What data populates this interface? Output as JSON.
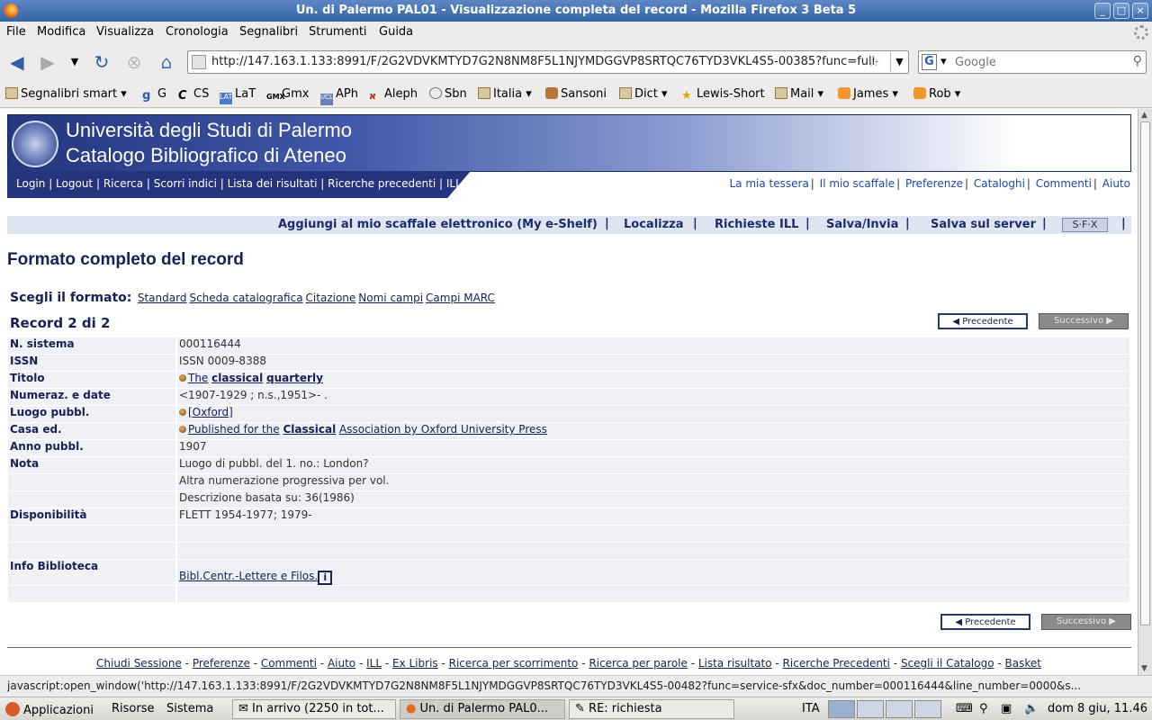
{
  "window": {
    "title": "Un. di Palermo PAL01 - Visualizzazione completa del record - Mozilla Firefox 3 Beta 5",
    "buttons": [
      "_",
      "□",
      "×"
    ]
  },
  "menu": [
    "File",
    "Modifica",
    "Visualizza",
    "Cronologia",
    "Segnalibri",
    "Strumenti",
    "Guida"
  ],
  "nav": {
    "url": "http://147.163.1.133:8991/F/2G2VDVKMTYD7G2N8NM8F5L1NJYMDGGVP8SRTQC76TYD3VKL4S5-00385?func=full-",
    "search_placeholder": "Google",
    "search_engine": "G"
  },
  "bookmarks": [
    {
      "label": "Segnalibri smart",
      "icon": "smart-bookmarks-icon",
      "dropdown": true
    },
    {
      "label": "G",
      "icon": "google-icon"
    },
    {
      "label": "CS",
      "icon": "cs-icon"
    },
    {
      "label": "LaT",
      "icon": "lat-icon"
    },
    {
      "label": "Gmx",
      "icon": "gmx-icon"
    },
    {
      "label": "APh",
      "icon": "aph-icon"
    },
    {
      "label": "Aleph",
      "icon": "aleph-icon"
    },
    {
      "label": "Sbn",
      "icon": "sbn-icon"
    },
    {
      "label": "Italia",
      "icon": "folder-icon",
      "dropdown": true
    },
    {
      "label": "Sansoni",
      "icon": "sansoni-icon"
    },
    {
      "label": "Dict",
      "icon": "folder-icon",
      "dropdown": true
    },
    {
      "label": "Lewis-Short",
      "icon": "star-icon"
    },
    {
      "label": "Mail",
      "icon": "folder-icon",
      "dropdown": true
    },
    {
      "label": "James",
      "icon": "feed-icon",
      "dropdown": true
    },
    {
      "label": "Rob",
      "icon": "feed-icon",
      "dropdown": true
    }
  ],
  "banner": {
    "line1": "Università degli Studi di Palermo",
    "line2": "Catalogo Bibliografico di Ateneo",
    "links": [
      "Login",
      "Logout",
      "Ricerca",
      "Scorri indici",
      "Lista dei risultati",
      "Ricerche precedenti",
      "ILL"
    ],
    "right_links": [
      "La mia tessera",
      "Il mio scaffale",
      "Preferenze",
      "Cataloghi",
      "Commenti",
      "Aiuto"
    ]
  },
  "actions": [
    "Aggiungi al mio scaffale elettronico (My e-Shelf)",
    "Localizza",
    "Richieste ILL",
    "Salva/Invia",
    "Salva sul server"
  ],
  "sfx_label": "S·F·X",
  "page_title": "Formato completo del record",
  "format": {
    "label": "Scegli il formato:",
    "options": [
      "Standard",
      "Scheda catalografica",
      "Citazione",
      "Nomi campi",
      "Campi MARC"
    ]
  },
  "record_label": "Record 2 di 2",
  "pager": {
    "prev": "Precedente",
    "next": "Successivo"
  },
  "record": {
    "sistema": {
      "key": "N. sistema",
      "value": "000116444"
    },
    "issn": {
      "key": "ISSN",
      "value": "ISSN 0009-8388"
    },
    "titolo": {
      "key": "Titolo",
      "the": "The",
      "classical": "classical",
      "quarterly": "quarterly"
    },
    "numeraz": {
      "key": "Numeraz. e date",
      "value": "<1907-1929 ; n.s.,1951>- ."
    },
    "luogo": {
      "key": "Luogo pubbl.",
      "value": "[Oxford]"
    },
    "casa": {
      "key": "Casa ed.",
      "pre": "Published for the",
      "classical": "Classical",
      "post": "Association by Oxford University Press"
    },
    "anno": {
      "key": "Anno pubbl.",
      "value": "1907"
    },
    "nota": {
      "key": "Nota",
      "values": [
        "Luogo di pubbl. del 1. no.: London?",
        "Altra numerazione progressiva per vol.",
        "Descrizione basata su: 36(1986)"
      ]
    },
    "disponibilita": {
      "key": "Disponibilità",
      "value": "FLETT 1954-1977; 1979-"
    },
    "info": {
      "key": "Info Biblioteca",
      "value": "Bibl.Centr.-Lettere e Filos.",
      "icon_text": "i"
    }
  },
  "footer_links": [
    "Chiudi Sessione",
    "Preferenze",
    "Commenti",
    "Aiuto",
    "ILL",
    "Ex Libris",
    "Ricerca per scorrimento",
    "Ricerca per parole",
    "Lista risultato",
    "Ricerche Precedenti",
    "Scegli il Catalogo",
    "Basket"
  ],
  "status": "javascript:open_window('http://147.163.1.133:8991/F/2G2VDVKMTYD7G2N8NM8F5L1NJYMDGGVP8SRTQC76TYD3VKL4S5-00482?func=service-sfx&doc_number=000116444&line_number=0000&s...",
  "panel": {
    "menus": [
      "Applicazioni",
      "Risorse",
      "Sistema"
    ],
    "tasks": [
      "In arrivo (2250 in tot...",
      "Un. di Palermo PAL0...",
      "RE: richiesta"
    ],
    "keyboard": "ITA",
    "clock": "dom  8 giu, 11.46"
  }
}
